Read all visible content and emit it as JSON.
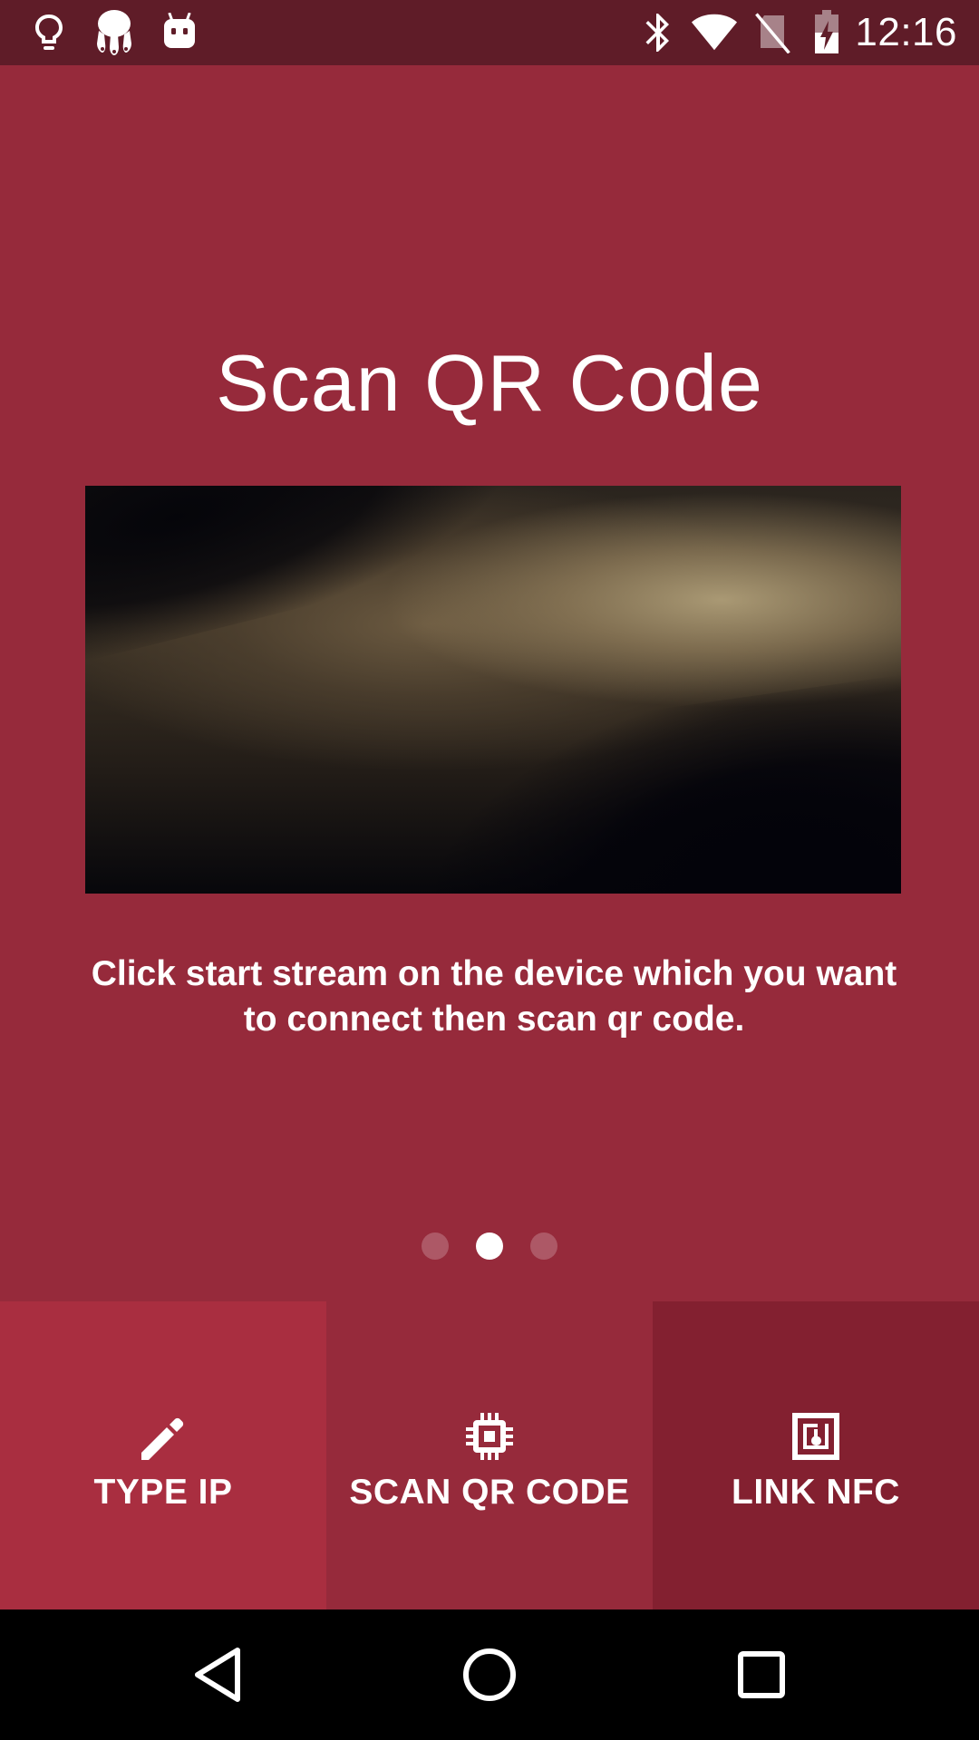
{
  "status_bar": {
    "time": "12:16",
    "icons": [
      "lightbulb-icon",
      "app-notification-icon",
      "android-icon",
      "bluetooth-icon",
      "wifi-icon",
      "no-sim-icon",
      "battery-charging-icon"
    ]
  },
  "main": {
    "title": "Scan QR Code",
    "instruction": "Click start stream on the device which you want to connect then scan qr code.",
    "page_indicator": {
      "count": 3,
      "active_index": 1
    }
  },
  "actions": [
    {
      "label": "TYPE IP",
      "icon": "pencil-icon"
    },
    {
      "label": "SCAN QR CODE",
      "icon": "chip-icon"
    },
    {
      "label": "LINK NFC",
      "icon": "nfc-icon"
    }
  ],
  "nav_bar": {
    "buttons": [
      "back-icon",
      "home-icon",
      "recents-icon"
    ]
  },
  "colors": {
    "background": "#962a3b",
    "status_bar": "#5f1c28",
    "type_ip_bg": "#a92e40",
    "scan_qr_bg": "#962a3b",
    "link_nfc_bg": "#832030"
  }
}
